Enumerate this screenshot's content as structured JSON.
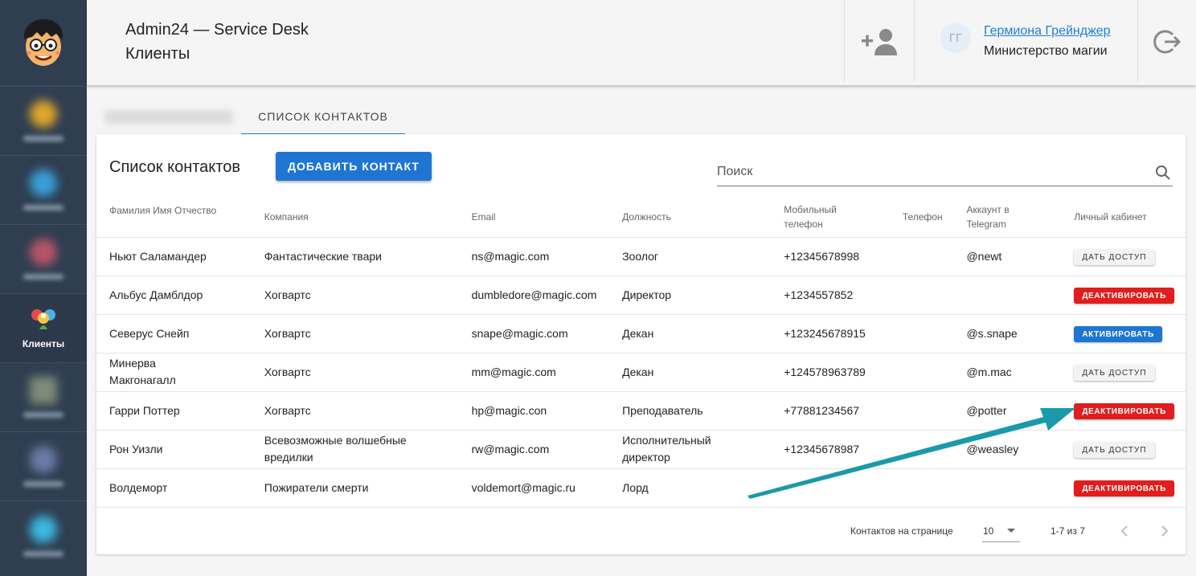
{
  "header": {
    "app_title": "Admin24 — Service Desk",
    "page_title": "Клиенты",
    "user": {
      "initials": "ГГ",
      "name": "Гермиона Грейнджер",
      "organization": "Министерство магии"
    }
  },
  "sidebar": {
    "active_label": "Клиенты"
  },
  "tabs": {
    "active_label": "СПИСОК КОНТАКТОВ"
  },
  "card": {
    "title": "Список контактов",
    "add_button": "ДОБАВИТЬ КОНТАКТ",
    "search_placeholder": "Поиск"
  },
  "table": {
    "headers": {
      "name": "Фамилия Имя Отчество",
      "company": "Компания",
      "email": "Email",
      "position": "Должность",
      "mobile": "Мобильный телефон",
      "phone": "Телефон",
      "telegram": "Аккаунт в Telegram",
      "cabinet": "Личный кабинет"
    },
    "rows": [
      {
        "name": "Ньют Саламандер",
        "company": "Фантастические твари",
        "email": "ns@magic.com",
        "position": "Зоолог",
        "mobile": "+12345678998",
        "phone": "",
        "telegram": "@newt",
        "action": "ДАТЬ ДОСТУП"
      },
      {
        "name": "Альбус Дамблдор",
        "company": "Хогвартс",
        "email": "dumbledore@magic.com",
        "position": "Директор",
        "mobile": "+1234557852",
        "phone": "",
        "telegram": "",
        "action": "ДЕАКТИВИРОВАТЬ"
      },
      {
        "name": "Северус Снейп",
        "company": "Хогвартс",
        "email": "snape@magic.com",
        "position": "Декан",
        "mobile": "+123245678915",
        "phone": "",
        "telegram": "@s.snape",
        "action": "АКТИВИРОВАТЬ"
      },
      {
        "name": "Минерва Макгонагалл",
        "company": "Хогвартс",
        "email": "mm@magic.com",
        "position": "Декан",
        "mobile": "+124578963789",
        "phone": "",
        "telegram": "@m.mac",
        "action": "ДАТЬ ДОСТУП"
      },
      {
        "name": "Гарри Поттер",
        "company": "Хогвартс",
        "email": "hp@magic.con",
        "position": "Преподаватель",
        "mobile": "+77881234567",
        "phone": "",
        "telegram": "@potter",
        "action": "ДЕАКТИВИРОВАТЬ"
      },
      {
        "name": "Рон Уизли",
        "company": "Всевозможные волшебные вредилки",
        "email": "rw@magic.com",
        "position": "Исполнительный директор",
        "mobile": "+12345678987",
        "phone": "",
        "telegram": "@weasley",
        "action": "ДАТЬ ДОСТУП"
      },
      {
        "name": "Волдеморт",
        "company": "Пожиратели смерти",
        "email": "voldemort@magic.ru",
        "position": "Лорд",
        "mobile": "",
        "phone": "",
        "telegram": "",
        "action": "ДЕАКТИВИРОВАТЬ"
      }
    ]
  },
  "pagination": {
    "rows_per_page_label": "Контактов на странице",
    "rows_per_page": "10",
    "range": "1-7 из 7"
  },
  "colors": {
    "primary": "#1f76d2",
    "danger": "#e11d1d",
    "sidebar": "#2f3e51",
    "annotation_arrow": "#1a9aa8"
  }
}
